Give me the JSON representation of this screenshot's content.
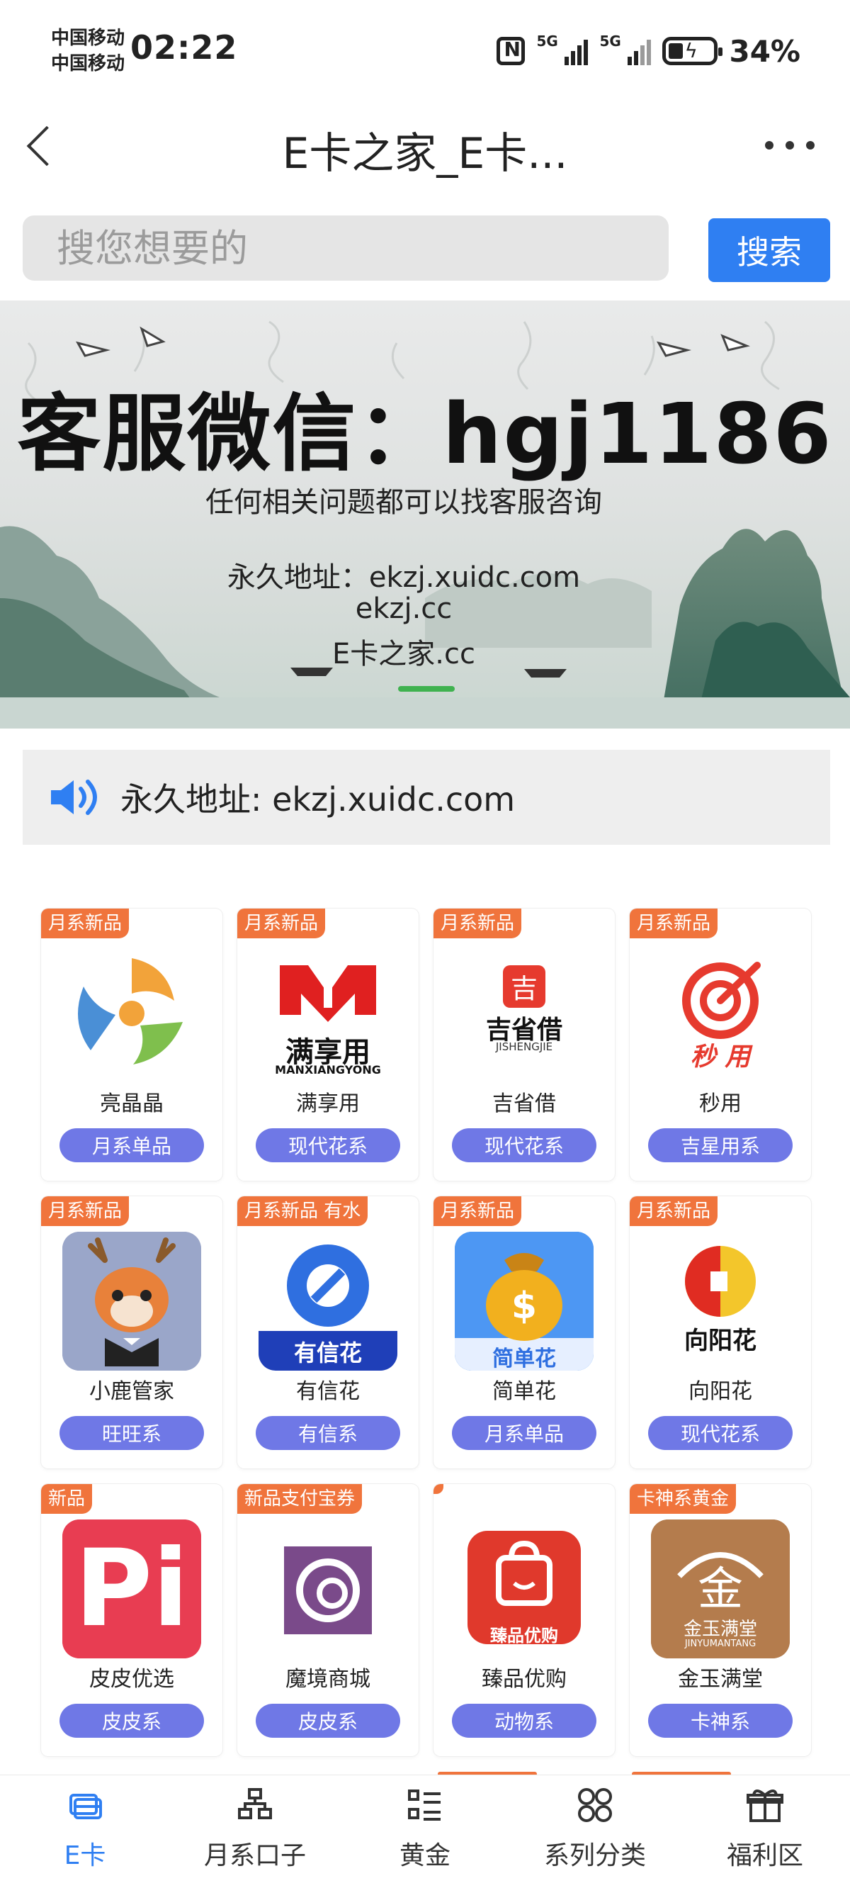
{
  "status_bar": {
    "carrier_1": "中国移动",
    "carrier_2": "中国移动",
    "time": "02:22",
    "signal_1_label": "5G",
    "signal_2_label": "5G",
    "battery": "34%"
  },
  "header": {
    "title": "E卡之家_E卡..."
  },
  "search": {
    "placeholder": "搜您想要的",
    "button_label": "搜索"
  },
  "banner": {
    "title": "客服微信：hgj1186",
    "subtitle": "任何相关问题都可以找客服咨询",
    "line_1": "永久地址：ekzj.xuidc.com",
    "line_2": "ekzj.cc",
    "line_3": "E卡之家.cc"
  },
  "notice": {
    "text": "永久地址: ekzj.xuidc.com",
    "icon": "speaker-icon"
  },
  "products": [
    {
      "tag": "月系新品",
      "name": "亮晶晶",
      "category": "月系单品",
      "logo_text": ""
    },
    {
      "tag": "月系新品",
      "name": "满享用",
      "category": "现代花系",
      "logo_text": "满享用",
      "logo_sub": "MANXIANGYONG"
    },
    {
      "tag": "月系新品",
      "name": "吉省借",
      "category": "现代花系",
      "logo_text": "吉省借",
      "logo_sub": "JISHENGJIE"
    },
    {
      "tag": "月系新品",
      "name": "秒用",
      "category": "吉星用系",
      "logo_text": "秒 用"
    },
    {
      "tag": "月系新品",
      "name": "小鹿管家",
      "category": "旺旺系",
      "logo_text": ""
    },
    {
      "tag": "月系新品 有水",
      "name": "有信花",
      "category": "有信系",
      "logo_text": "有信花"
    },
    {
      "tag": "月系新品",
      "name": "简单花",
      "category": "月系单品",
      "logo_text": "简单花"
    },
    {
      "tag": "月系新品",
      "name": "向阳花",
      "category": "现代花系",
      "logo_text": "向阳花"
    },
    {
      "tag": "新品",
      "name": "皮皮优选",
      "category": "皮皮系",
      "logo_text": "Pi"
    },
    {
      "tag": "新品支付宝券",
      "name": "魔境商城",
      "category": "皮皮系",
      "logo_text": ""
    },
    {
      "tag": "",
      "name": "臻品优购",
      "category": "动物系",
      "logo_text": "臻品优购"
    },
    {
      "tag": "卡神系黄金",
      "name": "金玉满堂",
      "category": "卡神系",
      "logo_text": "金玉满堂",
      "logo_sub": "JINYUMANTANG"
    }
  ],
  "bottom_nav": [
    {
      "label": "E卡",
      "icon": "card-icon",
      "active": true
    },
    {
      "label": "月系口子",
      "icon": "hierarchy-icon",
      "active": false
    },
    {
      "label": "黄金",
      "icon": "list-icon",
      "active": false
    },
    {
      "label": "系列分类",
      "icon": "grid-circles-icon",
      "active": false
    },
    {
      "label": "福利区",
      "icon": "gift-icon",
      "active": false
    }
  ],
  "colors": {
    "accent": "#2f7ff2",
    "tag": "#f0743c",
    "pill": "#6f78e6"
  }
}
